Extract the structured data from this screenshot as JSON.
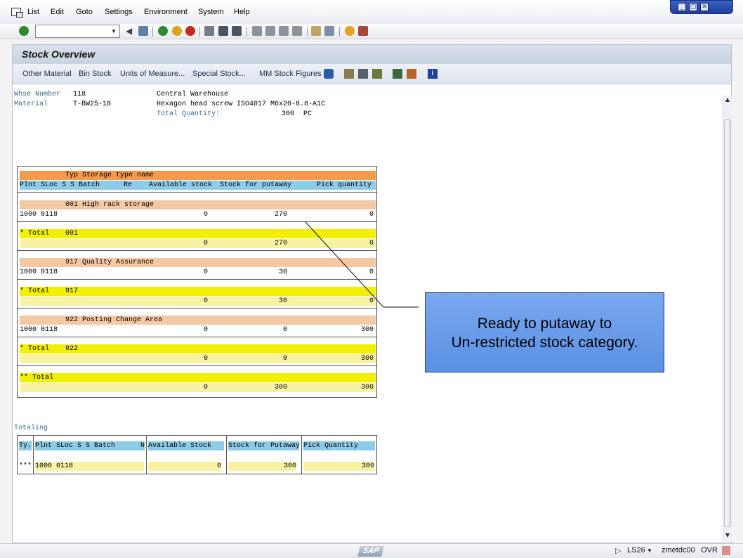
{
  "menu": {
    "items": [
      "List",
      "Edit",
      "Goto",
      "Settings",
      "Environment",
      "System",
      "Help"
    ]
  },
  "window_controls": {
    "minimize": "_",
    "restore": "▢",
    "close": "✕"
  },
  "toolbar": {
    "command_field_value": ""
  },
  "title": "Stock Overview",
  "app_toolbar": {
    "buttons": [
      "Other Material",
      "Bin Stock",
      "Units of Measure...",
      "Special Stock...",
      "MM Stock Figures"
    ]
  },
  "header": {
    "whse_label": "Whse Number",
    "whse_value": "118",
    "whse_desc": "Central Warehouse",
    "material_label": "Material",
    "material_value": "T-BW25-18",
    "material_desc": "Hexagon head screw ISO4017 M6x20-8.8-A1C",
    "total_qty_label": "Total Quantity:",
    "total_qty_value": "300",
    "total_qty_unit": "PC"
  },
  "list": {
    "header1": "Typ Storage type name",
    "header2_cols": [
      "Plnt SLoc S S Batch",
      "Re",
      "Available stock",
      "Stock for putaway",
      "Pick quantity"
    ],
    "groups": [
      {
        "type_line": "001 High rack storage",
        "plant_sloc": "1000 0118",
        "available": "0",
        "putaway": "270",
        "pick": "0",
        "total_label": "* Total",
        "total_type": "001",
        "total_available": "0",
        "total_putaway": "270",
        "total_pick": "0"
      },
      {
        "type_line": "917 Quality Assurance",
        "plant_sloc": "1000 0118",
        "available": "0",
        "putaway": "30",
        "pick": "0",
        "total_label": "* Total",
        "total_type": "917",
        "total_available": "0",
        "total_putaway": "30",
        "total_pick": "0"
      },
      {
        "type_line": "922 Posting Change Area",
        "plant_sloc": "1000 0118",
        "available": "0",
        "putaway": "0",
        "pick": "300",
        "total_label": "* Total",
        "total_type": "922",
        "total_available": "0",
        "total_putaway": "0",
        "total_pick": "300"
      }
    ],
    "grand_total_label": "** Total",
    "grand_total_available": "0",
    "grand_total_putaway": "300",
    "grand_total_pick": "300"
  },
  "totaling": {
    "label": "Totaling",
    "headers": [
      "Ty.",
      "Plnt SLoc S S Batch",
      "N",
      "Available Stock",
      "Stock for Putaway",
      "Pick Quantity"
    ],
    "row": {
      "ty": "***",
      "plant_sloc": "1000 0118",
      "available": "0",
      "putaway": "300",
      "pick": "300"
    }
  },
  "callout": {
    "line1": "Ready to putaway to",
    "line2": "Un-restricted stock category."
  },
  "status": {
    "system": "LS26",
    "server": "zmetdc00",
    "mode": "OVR",
    "logo": "SAP"
  }
}
